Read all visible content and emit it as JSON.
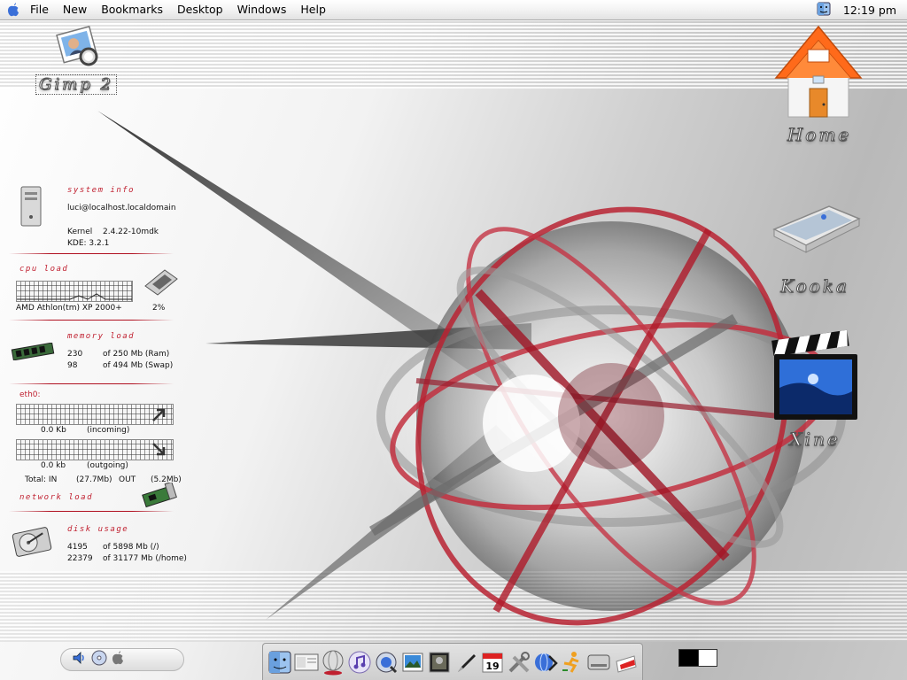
{
  "menubar": {
    "items": [
      "File",
      "New",
      "Bookmarks",
      "Desktop",
      "Windows",
      "Help"
    ],
    "clock": "12:19 pm"
  },
  "desktop_icons": {
    "gimp": {
      "label": "Gimp 2",
      "icon": "gimp-icon"
    },
    "home": {
      "label": "Home",
      "icon": "home-icon"
    },
    "scanner": {
      "label": "Kooka",
      "icon": "scanner-icon"
    },
    "video": {
      "label": "Xine",
      "icon": "clapperboard-icon"
    }
  },
  "sysinfo": {
    "system_title": "system info",
    "user_host": "luci@localhost.localdomain",
    "kernel_label": "Kernel",
    "kernel_value": "2.4.22-10mdk",
    "kde": "KDE: 3.2.1",
    "cpu_title": "cpu load",
    "cpu_name": "AMD Athlon(tm) XP 2000+",
    "cpu_percent": "2%",
    "cpu_load_fraction": 0.02,
    "memory_title": "memory load",
    "ram_value": "230",
    "ram_total": "of 250 Mb (Ram)",
    "swap_value": "98",
    "swap_total": "of 494 Mb (Swap)",
    "net_iface": "eth0:",
    "net_in_value": "0.0 Kb",
    "net_in_label": "(incoming)",
    "net_out_value": "0.0 kb",
    "net_out_label": "(outgoing)",
    "total_in_label": "Total: IN",
    "total_in_value": "(27.7Mb)",
    "total_out_label": "OUT",
    "total_out_value": "(5.2Mb)",
    "network_title": "network load",
    "disk_title": "disk usage",
    "disk_root_value": "4195",
    "disk_root_total": "of 5898 Mb (/)",
    "disk_home_value": "22379",
    "disk_home_total": "of 31177 Mb (/home)"
  },
  "dock": {
    "items": [
      "finder-icon",
      "mail-icon",
      "globe-icon",
      "itunes-icon",
      "quicktime-icon",
      "iphoto-icon",
      "preview-icon",
      "pen-icon",
      "calendar-icon",
      "tools-icon",
      "network-icon",
      "runner-icon",
      "harddisk-icon",
      "trash-icon"
    ],
    "calendar_day": "19"
  },
  "colors": {
    "accent_red": "#c02030",
    "home_roof": "#ff6a1a",
    "menubar": "#f3f3f3"
  }
}
